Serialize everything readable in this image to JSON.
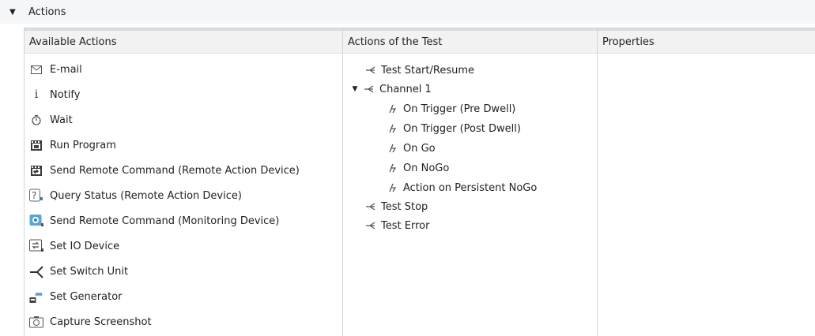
{
  "section": {
    "title": "Actions"
  },
  "panes": {
    "available": {
      "header": "Available Actions",
      "items": [
        {
          "label": "E-mail",
          "icon": "email-icon"
        },
        {
          "label": "Notify",
          "icon": "info-icon"
        },
        {
          "label": "Wait",
          "icon": "stopwatch-icon"
        },
        {
          "label": "Run Program",
          "icon": "program-icon"
        },
        {
          "label": "Send Remote Command (Remote Action Device)",
          "icon": "remote-command-icon"
        },
        {
          "label": "Query Status (Remote Action Device)",
          "icon": "query-status-icon"
        },
        {
          "label": "Send Remote Command (Monitoring Device)",
          "icon": "monitoring-device-icon"
        },
        {
          "label": "Set IO Device",
          "icon": "io-device-icon"
        },
        {
          "label": "Set Switch Unit",
          "icon": "switch-unit-icon"
        },
        {
          "label": "Set Generator",
          "icon": "generator-icon"
        },
        {
          "label": "Capture Screenshot",
          "icon": "camera-icon"
        }
      ]
    },
    "test": {
      "header": "Actions of the Test",
      "items": [
        {
          "label": "Test Start/Resume",
          "icon": "event-icon",
          "level": 0
        },
        {
          "label": "Channel 1",
          "icon": "event-icon",
          "level": 0,
          "expanded": true
        },
        {
          "label": "On Trigger (Pre Dwell)",
          "icon": "trigger-icon",
          "level": 1
        },
        {
          "label": "On Trigger (Post Dwell)",
          "icon": "trigger-icon",
          "level": 1
        },
        {
          "label": "On Go",
          "icon": "trigger-icon",
          "level": 1
        },
        {
          "label": "On NoGo",
          "icon": "trigger-icon",
          "level": 1
        },
        {
          "label": "Action on Persistent NoGo",
          "icon": "trigger-icon",
          "level": 1
        },
        {
          "label": "Test Stop",
          "icon": "event-icon",
          "level": 0
        },
        {
          "label": "Test Error",
          "icon": "event-icon",
          "level": 0
        }
      ]
    },
    "properties": {
      "header": "Properties"
    }
  }
}
